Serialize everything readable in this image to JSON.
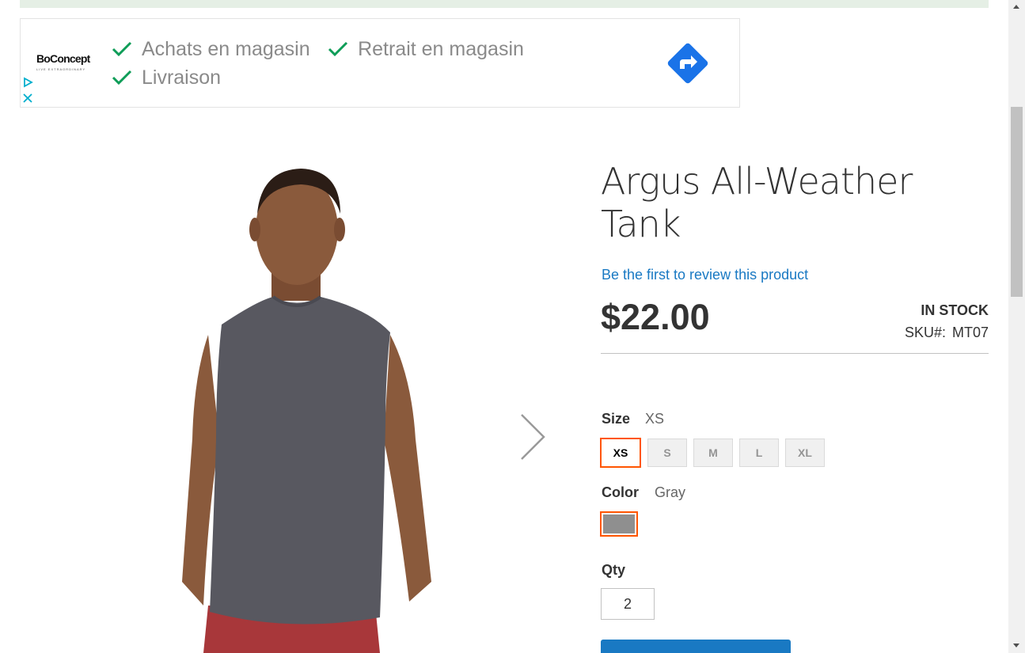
{
  "ad": {
    "brand": "BoConcept",
    "brand_tagline": "LIVE EXTRAORDINARY",
    "items": [
      "Achats en magasin",
      "Retrait en magasin",
      "Livraison"
    ],
    "icons": {
      "check": "check-icon",
      "directions": "directions-icon",
      "adchoices": "adchoices-icon",
      "close": "close-icon"
    },
    "colors": {
      "check": "#0f9d58",
      "directions": "#1a73e8"
    }
  },
  "product": {
    "title": "Argus All-Weather Tank",
    "review_link": "Be the first to review this product",
    "price": "$22.00",
    "stock": "IN STOCK",
    "sku_label": "SKU#:",
    "sku_value": "MT07"
  },
  "options": {
    "size_label": "Size",
    "size_selected": "XS",
    "sizes": [
      "XS",
      "S",
      "M",
      "L",
      "XL"
    ],
    "color_label": "Color",
    "color_selected": "Gray",
    "color_swatch": "#8f8f8f",
    "qty_label": "Qty",
    "qty_value": "2"
  },
  "colors": {
    "accent_link": "#1979c3",
    "selected_border": "#ff5501",
    "button": "#1979c3"
  }
}
